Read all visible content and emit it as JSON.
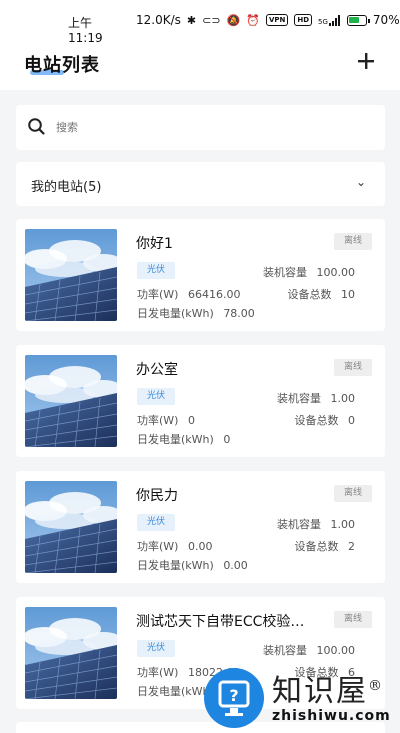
{
  "status_bar": {
    "time": "上午11:19",
    "speed": "12.0K/s",
    "icons": [
      "bluetooth-icon",
      "link-icon",
      "mute-icon",
      "alarm-icon"
    ],
    "vpn": "VPN",
    "hd": "HD",
    "network": "5G",
    "battery": "70%",
    "battery_level": 0.7
  },
  "header": {
    "title": "电站列表",
    "add_icon": "+"
  },
  "search": {
    "placeholder": "搜索"
  },
  "filter": {
    "label": "我的电站(5)",
    "chevron": "⌄"
  },
  "stations": [
    {
      "name": "你好1",
      "status": "离线",
      "type": "光伏",
      "capacity_label": "装机容量",
      "capacity": "100.00",
      "power_label": "功率(W)",
      "power": "66416.00",
      "device_label": "设备总数",
      "devices": "10",
      "energy_label": "日发电量(kWh)",
      "energy": "78.00"
    },
    {
      "name": "办公室",
      "status": "离线",
      "type": "光伏",
      "capacity_label": "装机容量",
      "capacity": "1.00",
      "power_label": "功率(W)",
      "power": "0",
      "device_label": "设备总数",
      "devices": "0",
      "energy_label": "日发电量(kWh)",
      "energy": "0"
    },
    {
      "name": "你民力",
      "status": "离线",
      "type": "光伏",
      "capacity_label": "装机容量",
      "capacity": "1.00",
      "power_label": "功率(W)",
      "power": "0.00",
      "device_label": "设备总数",
      "devices": "2",
      "energy_label": "日发电量(kWh)",
      "energy": "0.00"
    },
    {
      "name": "测试芯天下自带ECC校验…",
      "status": "离线",
      "type": "光伏",
      "capacity_label": "装机容量",
      "capacity": "100.00",
      "power_label": "功率(W)",
      "power": "18022.00",
      "device_label": "设备总数",
      "devices": "6",
      "energy_label": "日发电量(kWh)",
      "energy": ""
    }
  ],
  "watermark": {
    "cn": "知识屋",
    "registered": "®",
    "en": "zhishiwu.com"
  },
  "colors": {
    "accent": "#4a9cf5",
    "tag_blue_bg": "#e6f1fb",
    "tag_blue_text": "#3b8bd9",
    "offline_bg": "#eeeeee",
    "page_bg": "#f4f5f7",
    "battery_green": "#1fb34a"
  }
}
